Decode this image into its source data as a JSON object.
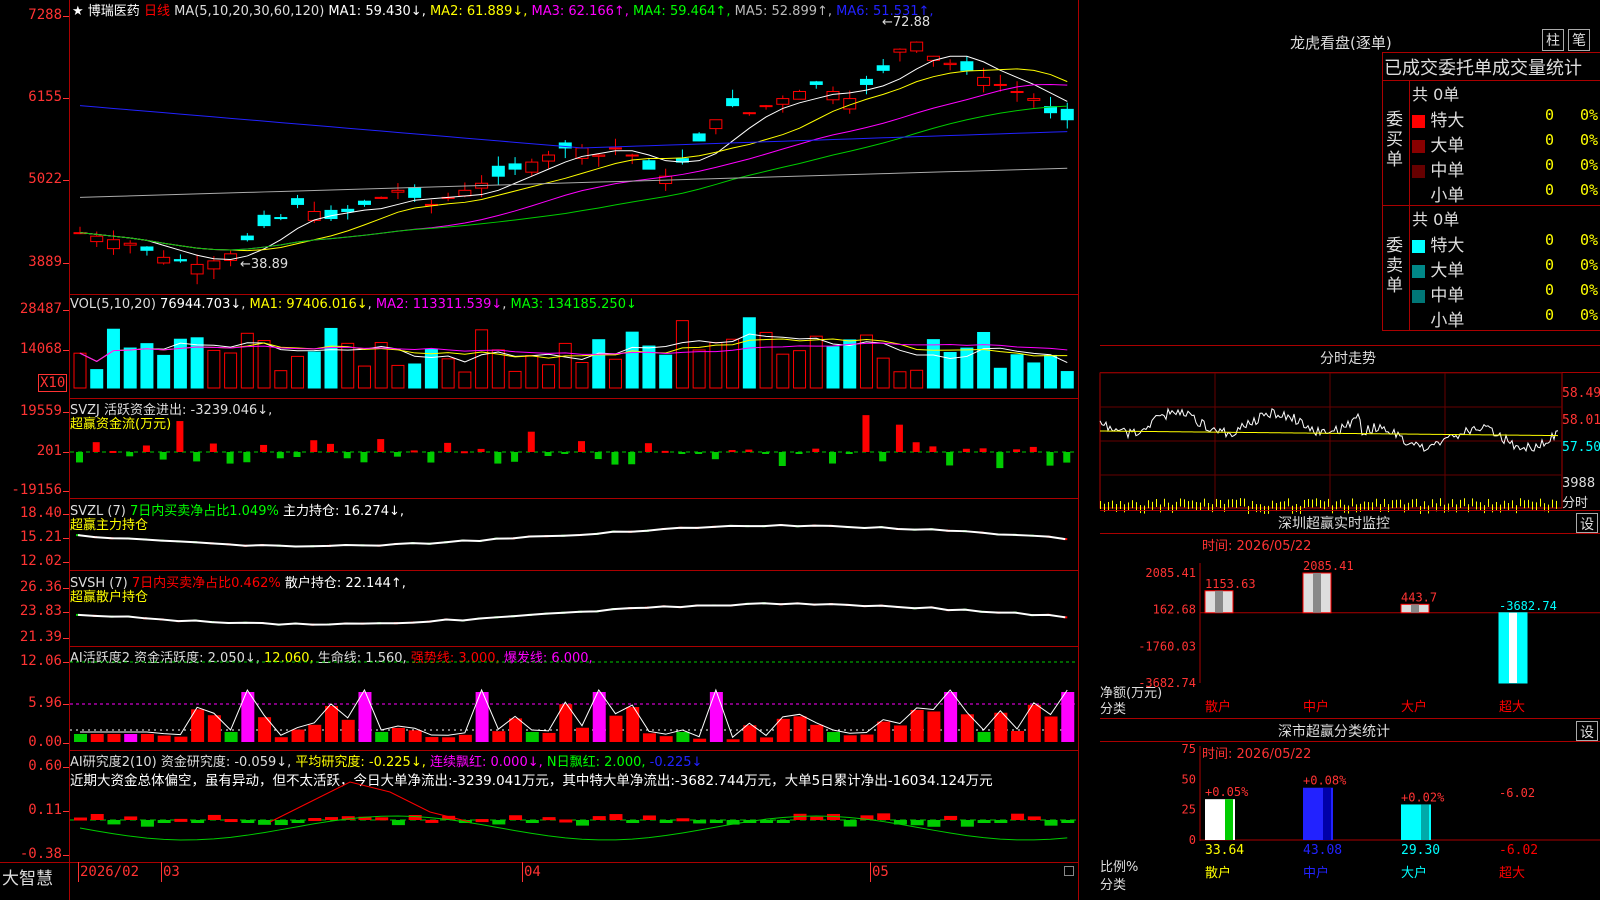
{
  "stock": {
    "star": "★",
    "name": "博瑞医药",
    "period": "日线"
  },
  "ma_header": {
    "label": "MA(5,10,20,30,60,120)",
    "items": [
      {
        "k": "MA1:",
        "v": "59.430↓",
        "c": "#fff"
      },
      {
        "k": "MA2:",
        "v": "61.889↓",
        "c": "#ff0"
      },
      {
        "k": "MA3:",
        "v": "62.166↑",
        "c": "#f0f"
      },
      {
        "k": "MA4:",
        "v": "59.464↑",
        "c": "#0f0"
      },
      {
        "k": "MA5:",
        "v": "52.899↑",
        "c": "#bbb"
      },
      {
        "k": "MA6:",
        "v": "51.531↑",
        "c": "#22f"
      }
    ]
  },
  "price_axis": [
    "7288",
    "6155",
    "5022",
    "3889"
  ],
  "price_marks": {
    "high": "72.88",
    "low": "38.89"
  },
  "vol_header": {
    "label": "VOL(5,10,20)",
    "v": "76944.703↓",
    "ma1": "MA1: 97406.016↓",
    "ma2": "MA2: 113311.539↓",
    "ma3": "MA3: 134185.250↓"
  },
  "vol_axis": [
    "28487",
    "14068"
  ],
  "vol_unit": "X10",
  "svzj": {
    "header": "SVZJ  活跃资金进出: -3239.046↓,",
    "sub": "超赢资金流(万元)",
    "axis": [
      "19559",
      "201",
      "-19156"
    ]
  },
  "svzl": {
    "h1": "SVZL (7)",
    "h2": "7日内买卖净占比1.049%",
    "h3": "主力持仓: 16.274↓,",
    "sub": "超赢主力持仓",
    "axis": [
      "18.40",
      "15.21",
      "12.02"
    ]
  },
  "svsh": {
    "h1": "SVSH (7)",
    "h2": "7日内买卖净占比0.462%",
    "h3": "散户持仓: 22.144↑,",
    "sub": "超赢散户持仓",
    "axis": [
      "26.36",
      "23.83",
      "21.39"
    ]
  },
  "ai1": {
    "h1": "AI活跃度2 资金活跃度: 2.050↓,",
    "h2": "12.060,",
    "h3": "生命线: 1.560,",
    "h4": "强势线: 3.000,",
    "h5": "爆发线: 6.000,",
    "axis": [
      "12.06",
      "5.96",
      "0.00"
    ]
  },
  "ai2": {
    "h1": "AI研究度2(10) 资金研究度: -0.059↓,",
    "h2": "平均研究度: -0.225↓,",
    "h3": "连续飘红: 0.000↓,",
    "h4": "N日飘红: 2.000,",
    "h5": "-0.225↓",
    "note": "近期大资金总体偏空，虽有异动，但不太活跃，今日大单净流出:-3239.041万元，其中特大单净流出:-3682.744万元，大单5日累计净出-16034.124万元",
    "axis": [
      "0.60",
      "0.11",
      "-0.38"
    ]
  },
  "bottom": {
    "brand": "大智慧",
    "months": [
      "2026/02",
      "03",
      "04",
      "05"
    ]
  },
  "lhb": {
    "title": "龙虎看盘(逐单)",
    "btn1": "柱",
    "btn2": "笔",
    "subtitle": "已成交委托单成交量统计",
    "buy": {
      "side": "委买单",
      "total": "共 0单",
      "rows": [
        {
          "l": "特大",
          "c": "#f00",
          "n": "0",
          "p": "0%"
        },
        {
          "l": "大单",
          "c": "#800",
          "n": "0",
          "p": "0%"
        },
        {
          "l": "中单",
          "c": "#600",
          "n": "0",
          "p": "0%"
        },
        {
          "l": "小单",
          "c": "#000",
          "n": "0",
          "p": "0%"
        }
      ]
    },
    "sell": {
      "side": "委卖单",
      "total": "共 0单",
      "rows": [
        {
          "l": "特大",
          "c": "#0ff",
          "n": "0",
          "p": "0%"
        },
        {
          "l": "大单",
          "c": "#088",
          "n": "0",
          "p": "0%"
        },
        {
          "l": "中单",
          "c": "#077",
          "n": "0",
          "p": "0%"
        },
        {
          "l": "小单",
          "c": "#000",
          "n": "0",
          "p": "0%"
        }
      ]
    }
  },
  "intraday": {
    "title": "分时走势",
    "axis": [
      "58.49",
      "58.01",
      "57.50"
    ],
    "vol_label": "3988",
    "unit": "分时"
  },
  "monitor": {
    "title": "深圳超赢实时监控",
    "btn": "设",
    "time": "时间: 2026/05/22",
    "axis": [
      "2085.41",
      "162.68",
      "-1760.03",
      "-3682.74"
    ],
    "ylabel": "净额(万元)",
    "xlabel": "分类",
    "bars": [
      {
        "cat": "散户",
        "v": 1153.63,
        "label": "1153.63"
      },
      {
        "cat": "中户",
        "v": 2085.41,
        "label": "2085.41"
      },
      {
        "cat": "大户",
        "v": 443.7,
        "label": "443.7"
      },
      {
        "cat": "超大",
        "v": -3682.74,
        "label": "-3682.74"
      }
    ]
  },
  "classify": {
    "title": "深市超赢分类统计",
    "btn": "设",
    "time": "时间: 2026/05/22",
    "axis": [
      "75",
      "50",
      "25",
      "0"
    ],
    "ylabel": "比例%",
    "xlabel": "分类",
    "bars": [
      {
        "cat": "散户",
        "v": 33.64,
        "d": "+0.05%",
        "c": "#fff",
        "c2": "#0c0"
      },
      {
        "cat": "中户",
        "v": 43.08,
        "d": "+0.08%",
        "c": "#22f",
        "c2": "#00a"
      },
      {
        "cat": "大户",
        "v": 29.3,
        "d": "+0.02%",
        "c": "#0ff",
        "c2": "#0aa"
      },
      {
        "cat": "超大",
        "v": -6.02,
        "d": "-6.02",
        "c": "#f00",
        "c2": "#f00"
      }
    ]
  }
}
